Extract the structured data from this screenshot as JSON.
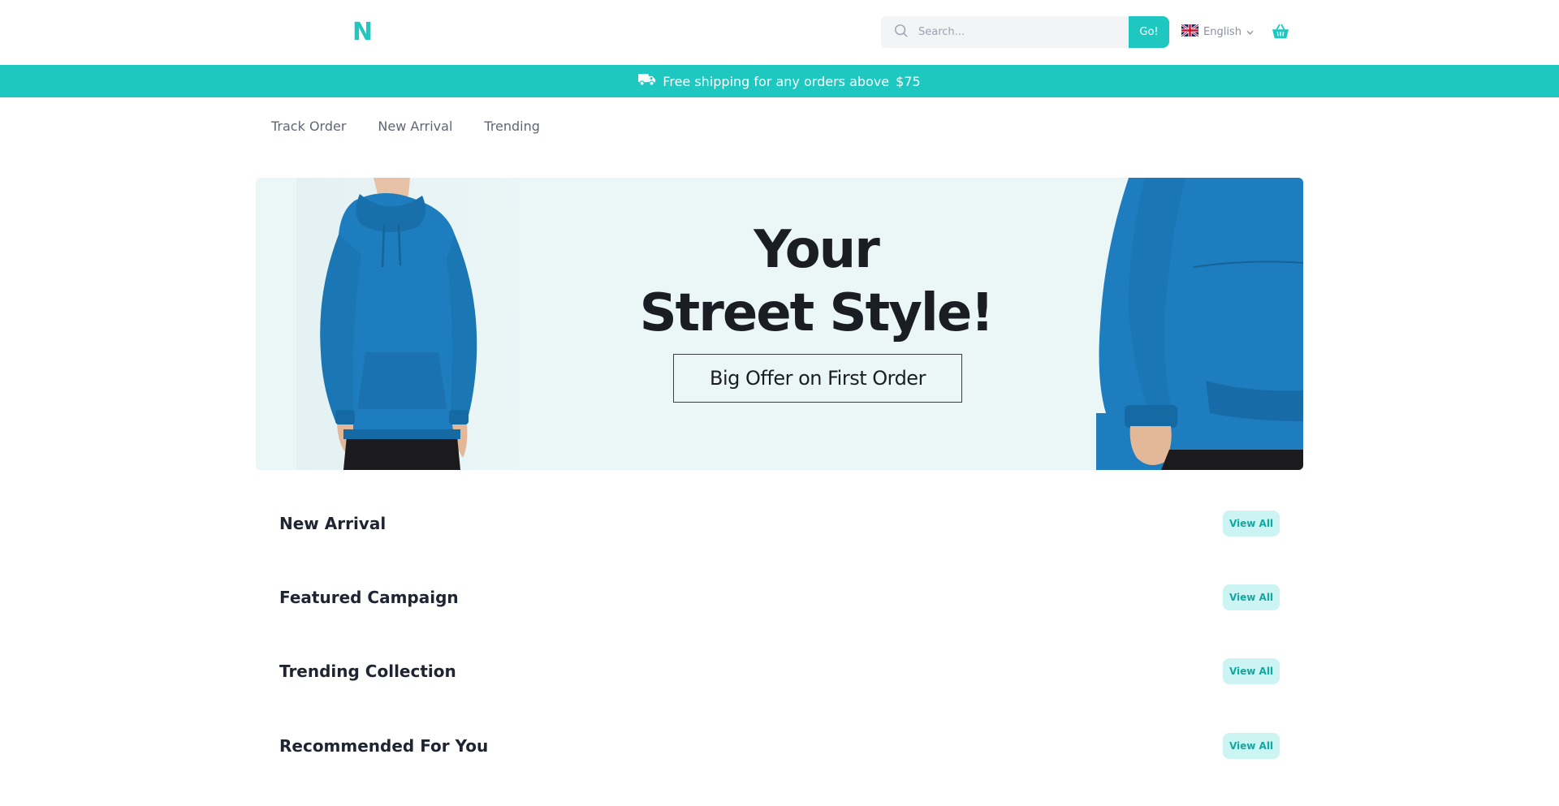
{
  "header": {
    "logo": "N",
    "search": {
      "placeholder": "Search...",
      "value": "",
      "button_label": "Go!"
    },
    "language": {
      "label": "English",
      "flag": "uk-flag-icon"
    },
    "cart_icon": "basket-icon"
  },
  "announcement": {
    "icon": "truck-icon",
    "text": "Free shipping for any orders above",
    "amount": "$75"
  },
  "nav": {
    "items": [
      {
        "label": "Track Order"
      },
      {
        "label": "New Arrival"
      },
      {
        "label": "Trending"
      }
    ]
  },
  "hero": {
    "title_line1": "Your",
    "title_line2": "Street Style!",
    "cta_label": "Big Offer on First Order"
  },
  "sections": [
    {
      "title": "New Arrival",
      "action_label": "View All"
    },
    {
      "title": "Featured Campaign",
      "action_label": "View All"
    },
    {
      "title": "Trending Collection",
      "action_label": "View All"
    },
    {
      "title": "Recommended For You",
      "action_label": "View All"
    }
  ],
  "colors": {
    "accent": "#1ec7c0",
    "accent_soft": "#cbf4f2",
    "hero_bg": "#ebf6f7",
    "hoodie_blue": "#1d7dbe",
    "text_dark": "#1f2433"
  }
}
